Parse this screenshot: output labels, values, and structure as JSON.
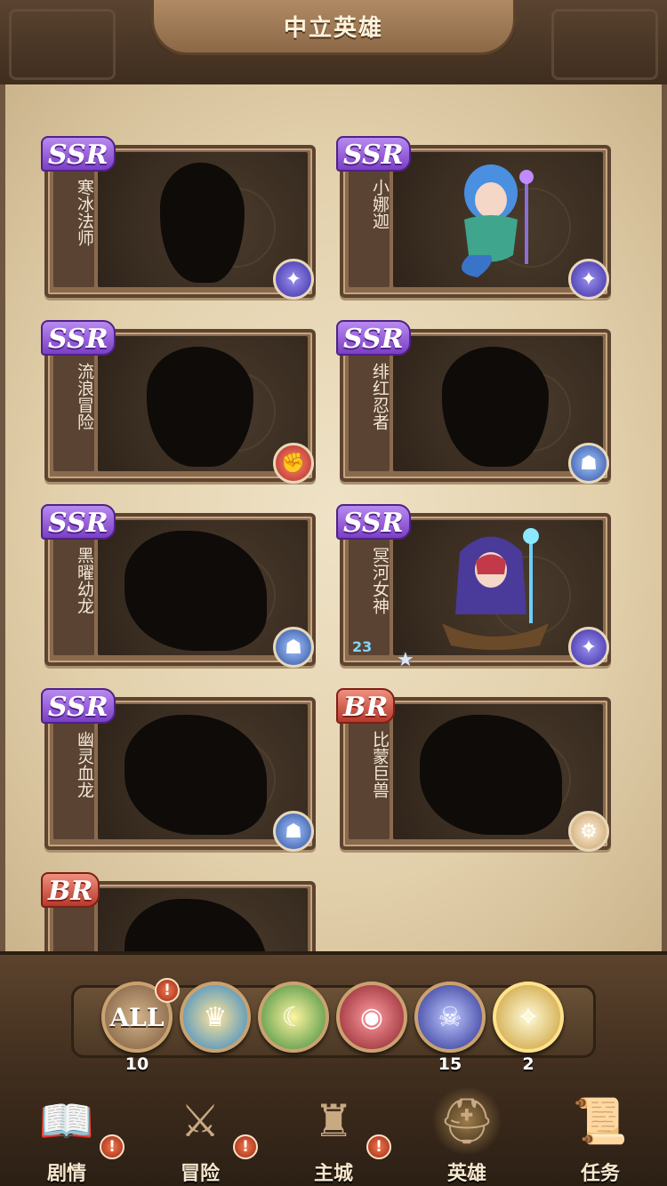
{
  "header": {
    "title": "中立英雄"
  },
  "heroes": [
    {
      "name": "寒冰法师",
      "rarity": "SSR",
      "faction_icon": "celestial-icon",
      "revealed": false
    },
    {
      "name": "小娜迦",
      "rarity": "SSR",
      "faction_icon": "celestial-icon",
      "revealed": true
    },
    {
      "name": "流浪冒险",
      "rarity": "SSR",
      "faction_icon": "mauler-icon",
      "revealed": false
    },
    {
      "name": "绯红忍者",
      "rarity": "SSR",
      "faction_icon": "graveborn-icon",
      "revealed": false
    },
    {
      "name": "黑曜幼龙",
      "rarity": "SSR",
      "faction_icon": "graveborn-icon",
      "revealed": false
    },
    {
      "name": "冥河女神",
      "rarity": "SSR",
      "faction_icon": "celestial-icon",
      "revealed": true,
      "level": "23",
      "stars": 1
    },
    {
      "name": "幽灵血龙",
      "rarity": "SSR",
      "faction_icon": "graveborn-icon",
      "revealed": false
    },
    {
      "name": "比蒙巨兽",
      "rarity": "BR",
      "faction_icon": "dimensional-icon",
      "revealed": false
    },
    {
      "name": "",
      "rarity": "BR",
      "faction_icon": "",
      "revealed": false
    }
  ],
  "filters": {
    "all": {
      "label": "ALL",
      "count": "10",
      "alert": "!"
    },
    "lightbearer": {
      "count": ""
    },
    "wilder": {
      "count": ""
    },
    "mauler": {
      "count": ""
    },
    "graveborn": {
      "count": "15"
    },
    "celestial": {
      "count": "2"
    }
  },
  "nav": [
    {
      "label": "剧情",
      "icon": "book-icon",
      "alert": "!"
    },
    {
      "label": "冒险",
      "icon": "crossed-swords-icon",
      "alert": "!"
    },
    {
      "label": "主城",
      "icon": "castle-icon",
      "alert": "!"
    },
    {
      "label": "英雄",
      "icon": "helmet-icon",
      "active": true
    },
    {
      "label": "任务",
      "icon": "scroll-icon"
    }
  ],
  "colors": {
    "ssr": "#7b3fc4",
    "br": "#b63a2c",
    "parchment": "#e2d0ab",
    "frame": "#5d4330"
  }
}
